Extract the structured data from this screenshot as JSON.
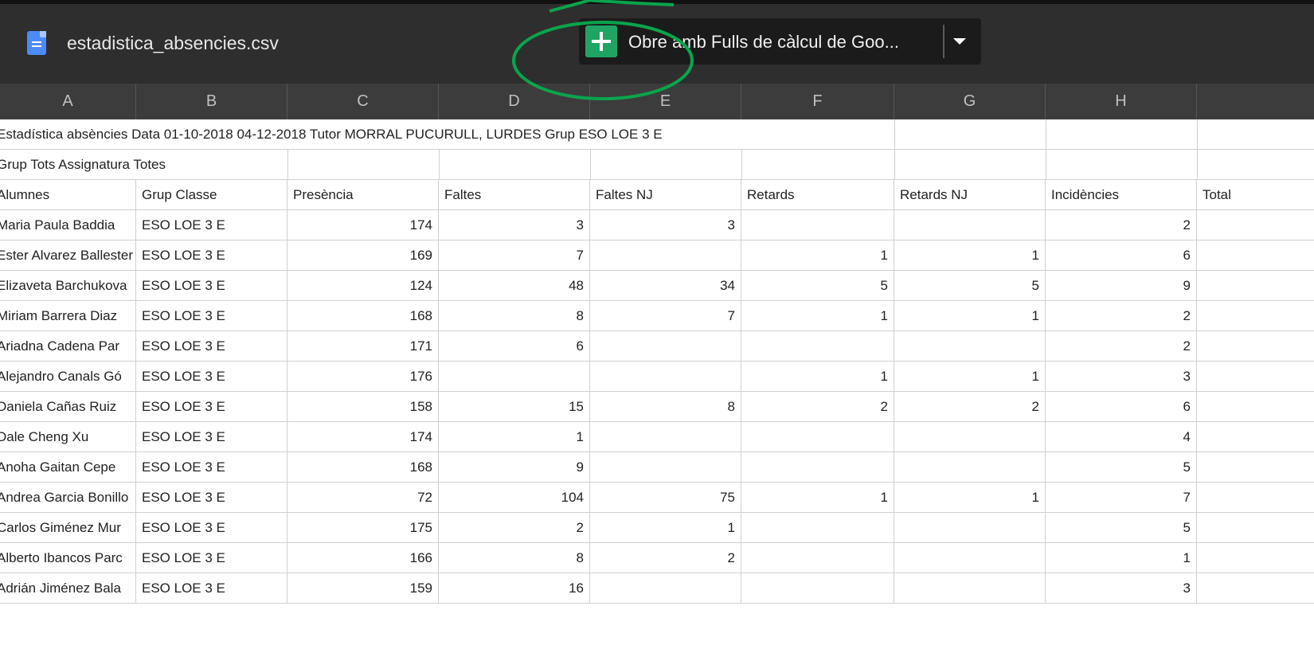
{
  "topbar": {
    "file_name": "estadistica_absencies.csv",
    "open_with_label": "Obre amb Fulls de càlcul de Goo..."
  },
  "columns": [
    "A",
    "B",
    "C",
    "D",
    "E",
    "F",
    "G",
    "H"
  ],
  "sheet": {
    "title_row": "Estadística absències Data 01-10-2018 04-12-2018 Tutor MORRAL PUCURULL, LURDES Grup ESO LOE 3 E",
    "subtitle_row": "Grup Tots Assignatura Totes",
    "headers": [
      "Alumnes",
      "Grup Classe",
      "Presència",
      "Faltes",
      "Faltes NJ",
      "Retards",
      "Retards NJ",
      "Incidències",
      "Total"
    ],
    "rows": [
      [
        "Maria Paula Baddia",
        "ESO LOE 3 E",
        "174",
        "3",
        "3",
        "",
        "",
        "2",
        ""
      ],
      [
        "Ester Alvarez Ballester",
        "ESO LOE 3 E",
        "169",
        "7",
        "",
        "1",
        "1",
        "6",
        ""
      ],
      [
        "Elizaveta Barchukova",
        "ESO LOE 3 E",
        "124",
        "48",
        "34",
        "5",
        "5",
        "9",
        ""
      ],
      [
        "Miriam Barrera Diaz",
        "ESO LOE 3 E",
        "168",
        "8",
        "7",
        "1",
        "1",
        "2",
        ""
      ],
      [
        "Ariadna Cadena Par",
        "ESO LOE 3 E",
        "171",
        "6",
        "",
        "",
        "",
        "2",
        ""
      ],
      [
        "Alejandro Canals Gó",
        "ESO LOE 3 E",
        "176",
        "",
        "",
        "1",
        "1",
        "3",
        ""
      ],
      [
        "Daniela Cañas Ruiz",
        "ESO LOE 3 E",
        "158",
        "15",
        "8",
        "2",
        "2",
        "6",
        ""
      ],
      [
        "Dale Cheng Xu",
        "ESO LOE 3 E",
        "174",
        "1",
        "",
        "",
        "",
        "4",
        ""
      ],
      [
        "Anoha Gaitan Cepe",
        "ESO LOE 3 E",
        "168",
        "9",
        "",
        "",
        "",
        "5",
        ""
      ],
      [
        "Andrea Garcia Bonillo",
        "ESO LOE 3 E",
        "72",
        "104",
        "75",
        "1",
        "1",
        "7",
        ""
      ],
      [
        "Carlos Giménez Mur",
        "ESO LOE 3 E",
        "175",
        "2",
        "1",
        "",
        "",
        "5",
        ""
      ],
      [
        "Alberto Ibancos Parc",
        "ESO LOE 3 E",
        "166",
        "8",
        "2",
        "",
        "",
        "1",
        ""
      ],
      [
        "Adrián Jiménez Bala",
        "ESO LOE 3 E",
        "159",
        "16",
        "",
        "",
        "",
        "3",
        ""
      ]
    ]
  },
  "colors": {
    "sheets_green": "#1fa463",
    "annotation_green": "#0aa44c"
  }
}
